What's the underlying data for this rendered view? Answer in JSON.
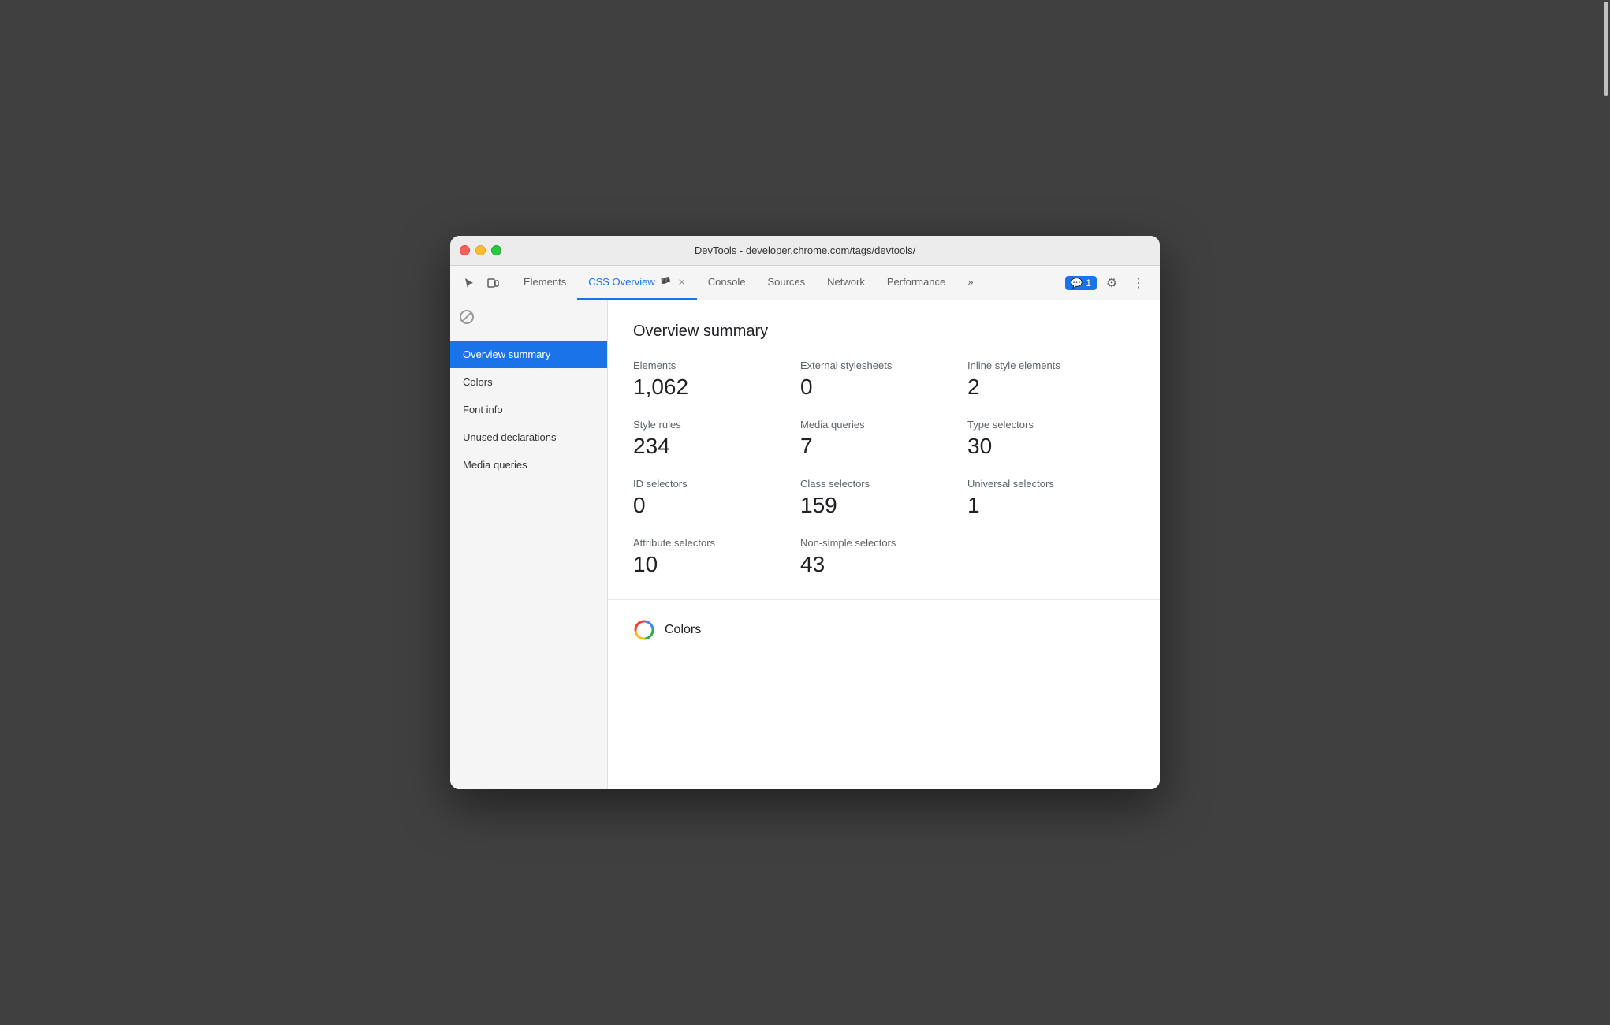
{
  "window": {
    "title": "DevTools - developer.chrome.com/tags/devtools/"
  },
  "tabs": [
    {
      "id": "elements",
      "label": "Elements",
      "active": false,
      "closeable": false
    },
    {
      "id": "css-overview",
      "label": "CSS Overview",
      "active": true,
      "closeable": true,
      "icon": "🏴"
    },
    {
      "id": "console",
      "label": "Console",
      "active": false,
      "closeable": false
    },
    {
      "id": "sources",
      "label": "Sources",
      "active": false,
      "closeable": false
    },
    {
      "id": "network",
      "label": "Network",
      "active": false,
      "closeable": false
    },
    {
      "id": "performance",
      "label": "Performance",
      "active": false,
      "closeable": false
    }
  ],
  "toolbar": {
    "more_tabs_label": "»",
    "chat_count": "1",
    "settings_icon": "⚙",
    "more_icon": "⋮"
  },
  "sidebar": {
    "items": [
      {
        "id": "overview-summary",
        "label": "Overview summary",
        "active": true
      },
      {
        "id": "colors",
        "label": "Colors",
        "active": false
      },
      {
        "id": "font-info",
        "label": "Font info",
        "active": false
      },
      {
        "id": "unused-declarations",
        "label": "Unused declarations",
        "active": false
      },
      {
        "id": "media-queries",
        "label": "Media queries",
        "active": false
      }
    ]
  },
  "main": {
    "section_title": "Overview summary",
    "stats": [
      {
        "label": "Elements",
        "value": "1,062"
      },
      {
        "label": "External stylesheets",
        "value": "0"
      },
      {
        "label": "Inline style elements",
        "value": "2"
      },
      {
        "label": "Style rules",
        "value": "234"
      },
      {
        "label": "Media queries",
        "value": "7"
      },
      {
        "label": "Type selectors",
        "value": "30"
      },
      {
        "label": "ID selectors",
        "value": "0"
      },
      {
        "label": "Class selectors",
        "value": "159"
      },
      {
        "label": "Universal selectors",
        "value": "1"
      },
      {
        "label": "Attribute selectors",
        "value": "10"
      },
      {
        "label": "Non-simple selectors",
        "value": "43"
      }
    ],
    "colors_heading": "Colors"
  },
  "colors": {
    "accent": "#1a73e8",
    "active_bg": "#1a73e8"
  }
}
